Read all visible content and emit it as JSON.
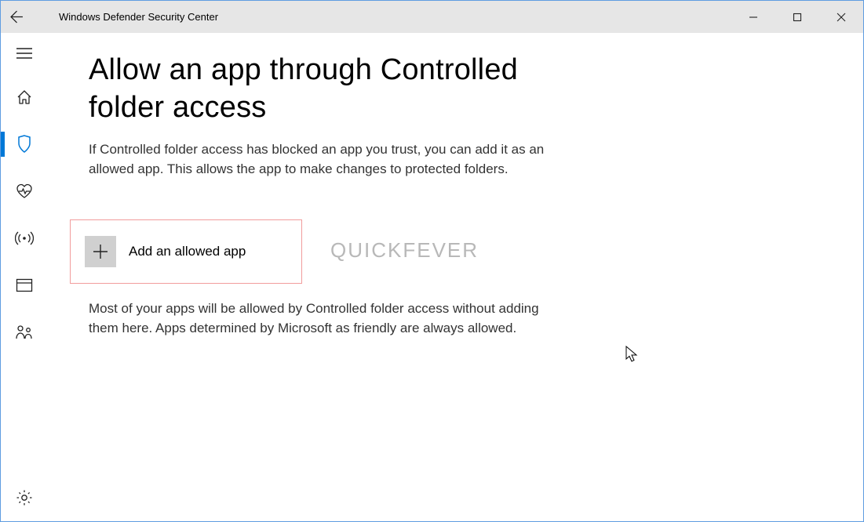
{
  "titlebar": {
    "title": "Windows Defender Security Center"
  },
  "page": {
    "heading": "Allow an app through Controlled folder access",
    "description": "If Controlled folder access has blocked an app you trust, you can add it as an allowed app. This allows the app to make changes to protected folders.",
    "add_button_label": "Add an allowed app",
    "note": "Most of your apps will be allowed by Controlled folder access without adding them here. Apps determined by Microsoft as friendly are always allowed."
  },
  "watermark": "QUICKFEVER",
  "sidebar": {
    "items": [
      {
        "name": "menu",
        "active": false
      },
      {
        "name": "home",
        "active": false
      },
      {
        "name": "virus-protection",
        "active": true
      },
      {
        "name": "device-health",
        "active": false
      },
      {
        "name": "firewall-network",
        "active": false
      },
      {
        "name": "app-browser-control",
        "active": false
      },
      {
        "name": "family-options",
        "active": false
      },
      {
        "name": "settings",
        "active": false
      }
    ]
  }
}
